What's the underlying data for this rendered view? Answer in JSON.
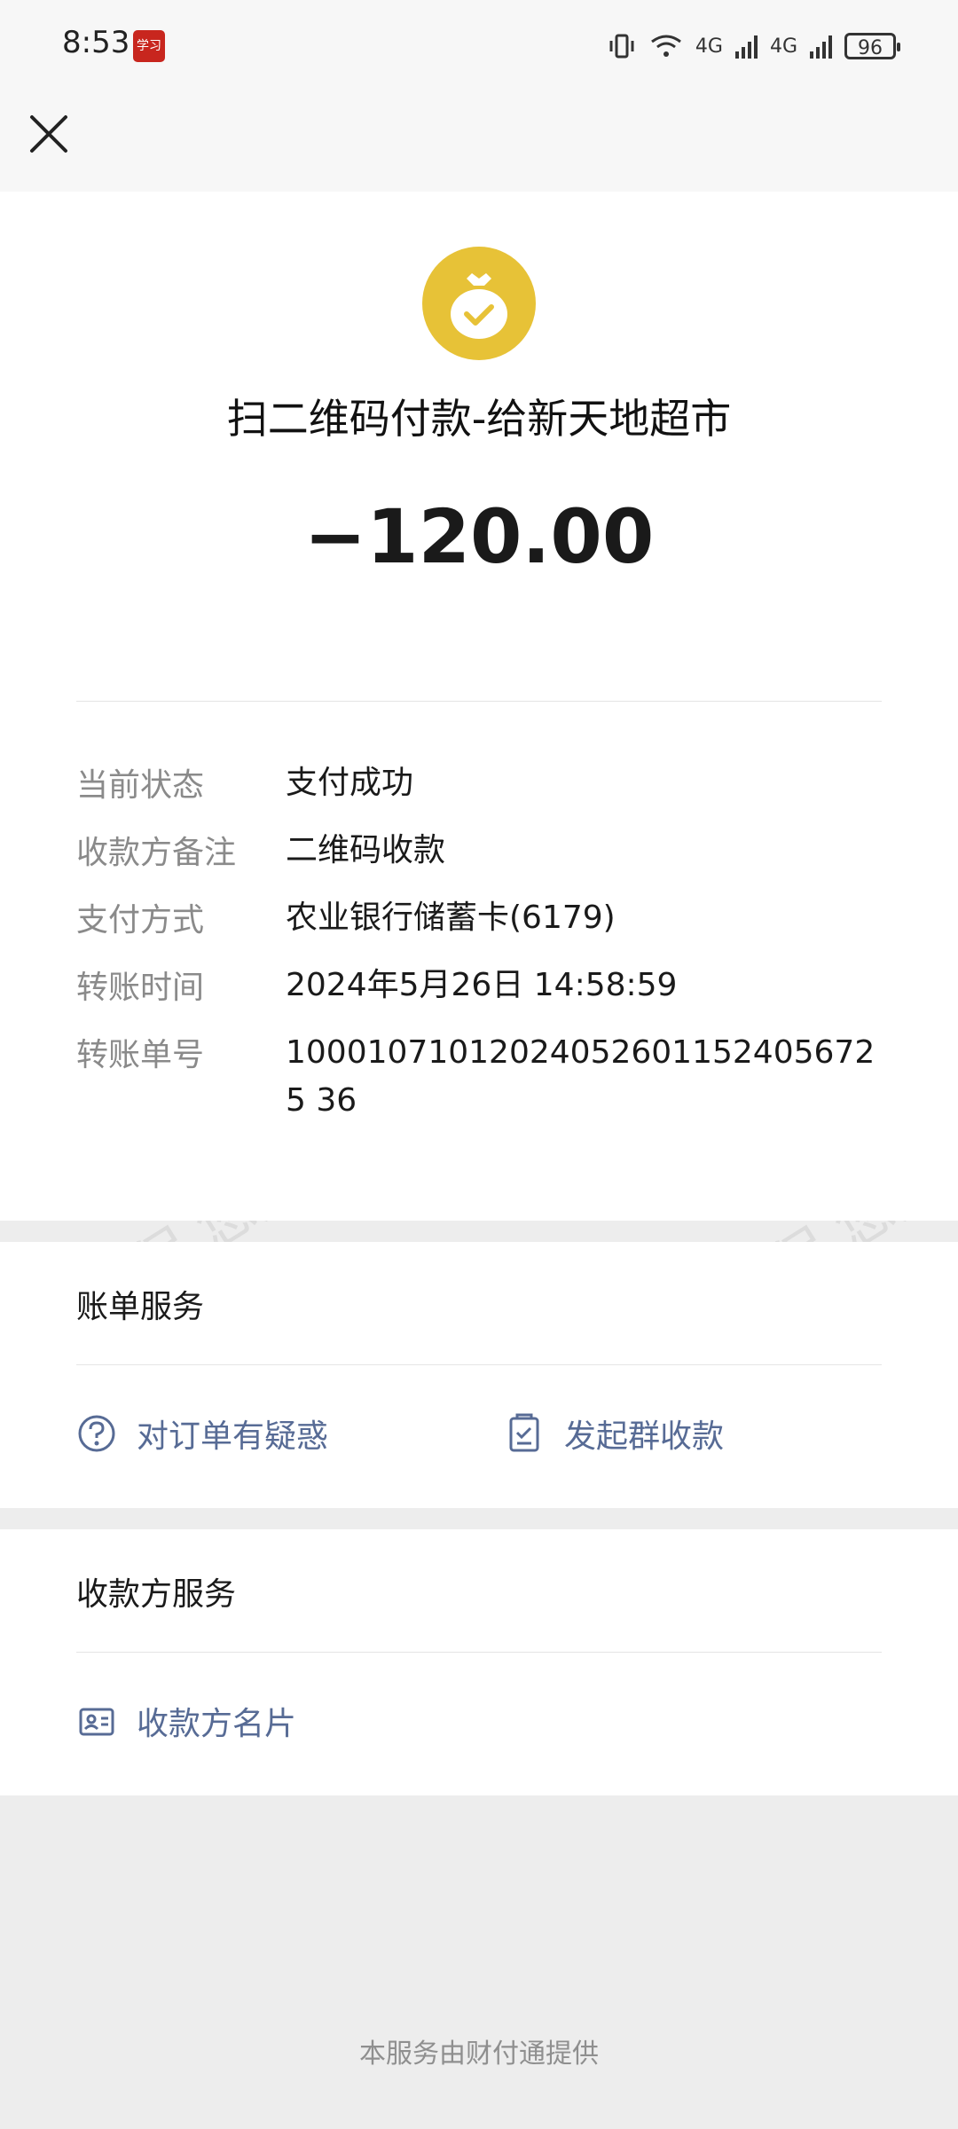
{
  "status_bar": {
    "time": "8:53",
    "app_badge": "学习",
    "network_1": "4G",
    "network_2": "4G",
    "battery": "96"
  },
  "transaction": {
    "icon": "money-bag-check-icon",
    "title": "扫二维码付款-给新天地超市",
    "amount": "−120.00"
  },
  "details": [
    {
      "label": "当前状态",
      "value": "支付成功"
    },
    {
      "label": "收款方备注",
      "value": "二维码收款"
    },
    {
      "label": "支付方式",
      "value": "农业银行储蓄卡(6179)"
    },
    {
      "label": "转账时间",
      "value": "2024年5月26日 14:58:59"
    },
    {
      "label": "转账单号",
      "value": "100010710120240526011524056725 36"
    }
  ],
  "bill_service": {
    "title": "账单服务",
    "actions": [
      {
        "label": "对订单有疑惑",
        "icon": "question-circle-icon"
      },
      {
        "label": "发起群收款",
        "icon": "group-receipt-icon"
      }
    ]
  },
  "payee_service": {
    "title": "收款方服务",
    "actions": [
      {
        "label": "收款方名片",
        "icon": "business-card-icon"
      }
    ]
  },
  "footer": "本服务由财付通提供",
  "watermark": "消费保 您身边的消费服务管家",
  "colors": {
    "link": "#576b95",
    "bag_icon": "#e7c237",
    "label_gray": "#8a8a8a",
    "background": "#ededed"
  }
}
